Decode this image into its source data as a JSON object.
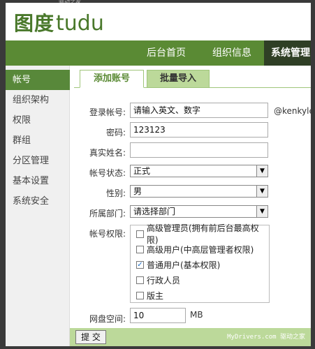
{
  "logo": {
    "cn": "图度",
    "en": "tudu"
  },
  "nav": {
    "items": [
      "后台首页",
      "组织信息",
      "系统管理"
    ]
  },
  "sidebar": {
    "items": [
      "帐号",
      "组织架构",
      "权限",
      "群组",
      "分区管理",
      "基本设置",
      "系统安全"
    ]
  },
  "tabs": [
    "添加账号",
    "批量导入"
  ],
  "form": {
    "login_label": "登录帐号:",
    "login_placeholder": "请输入英文、数字",
    "domain_suffix": "@kenkyle",
    "password_label": "密码:",
    "password_value": "123123",
    "realname_label": "真实姓名:",
    "realname_value": "",
    "status_label": "帐号状态:",
    "status_value": "正式",
    "gender_label": "性别:",
    "gender_value": "男",
    "dept_label": "所属部门:",
    "dept_value": "请选择部门",
    "perm_label": "帐号权限:",
    "permissions": [
      {
        "label": "高级管理员(拥有前后台最高权限)",
        "checked": false
      },
      {
        "label": "高级用户(中高层管理者权限)",
        "checked": false
      },
      {
        "label": "普通用户(基本权限)",
        "checked": true
      },
      {
        "label": "行政人员",
        "checked": false
      },
      {
        "label": "版主",
        "checked": false
      }
    ],
    "disk_label": "网盘空间:",
    "disk_value": "10",
    "disk_unit": "MB",
    "submit_label": "提 交"
  },
  "watermark": "MyDrivers.com 驱动之家",
  "colors": {
    "brand_green": "#5a8a34",
    "nav_active": "#2f3f25",
    "light_green": "#bcd99a"
  },
  "top_strip_text": "驱动之家"
}
